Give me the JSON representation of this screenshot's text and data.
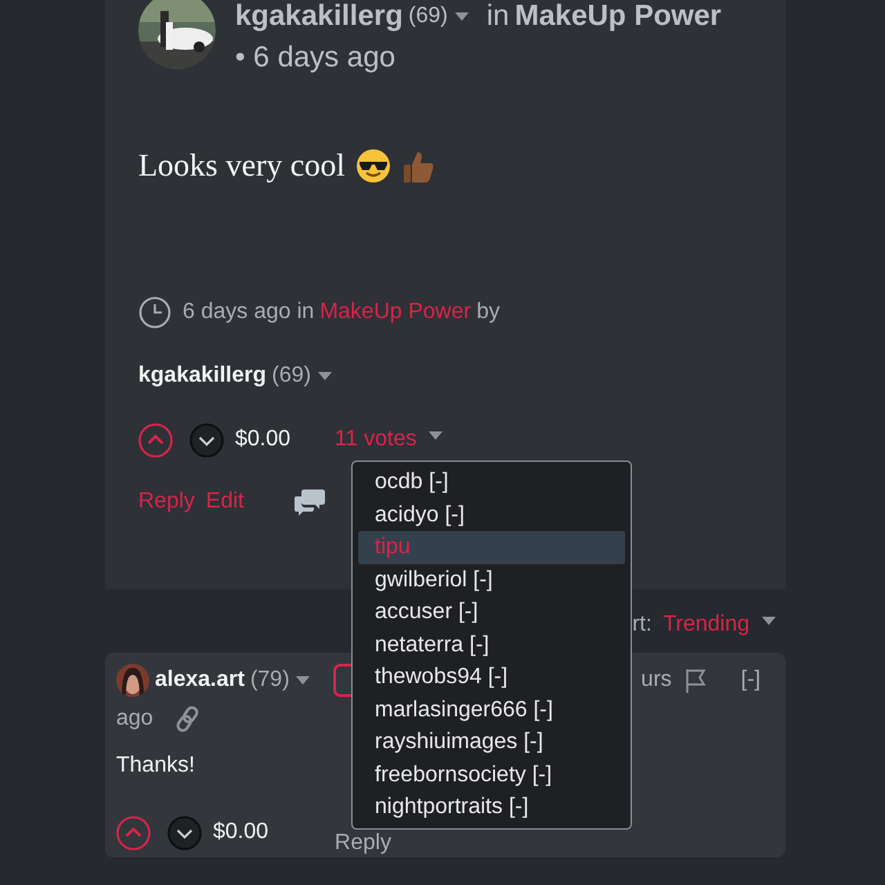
{
  "post": {
    "author": "kgakakillerg",
    "reputation": "(69)",
    "community_prefix": "in",
    "community": "MakeUp Power",
    "time": "• 6 days ago",
    "body": "Looks very cool"
  },
  "footer": {
    "time": "6 days ago in",
    "community": "MakeUp Power",
    "by": "by",
    "author": "kgakakillerg",
    "reputation": "(69)",
    "payout": "$0.00",
    "votes": "11 votes",
    "actions": [
      "Reply",
      "Edit"
    ]
  },
  "voters_menu": {
    "items": [
      {
        "name": "ocdb",
        "remove": "[-]",
        "selected": false
      },
      {
        "name": "acidyo",
        "remove": "[-]",
        "selected": false
      },
      {
        "name": "tipu",
        "selected": true
      },
      {
        "name": "gwilberiol",
        "remove": "[-]",
        "selected": false
      },
      {
        "name": "accuser",
        "remove": "[-]",
        "selected": false
      },
      {
        "name": "netaterra",
        "remove": "[-]",
        "selected": false
      },
      {
        "name": "thewobs94",
        "remove": "[-]",
        "selected": false
      },
      {
        "name": "marlasinger666",
        "remove": "[-]",
        "selected": false
      },
      {
        "name": "rayshiuimages",
        "remove": "[-]",
        "selected": false
      },
      {
        "name": "freebornsociety",
        "remove": "[-]",
        "selected": false
      },
      {
        "name": "nightportraits",
        "remove": "[-]",
        "selected": false
      }
    ]
  },
  "sort": {
    "label": "rt:",
    "value": "Trending"
  },
  "comment": {
    "author": "alexa.art",
    "reputation": "(79)",
    "time_fragment": "urs",
    "collapse": "[-]",
    "time_end": "ago",
    "body": "Thanks!",
    "payout": "$0.00",
    "reply": "Reply"
  }
}
